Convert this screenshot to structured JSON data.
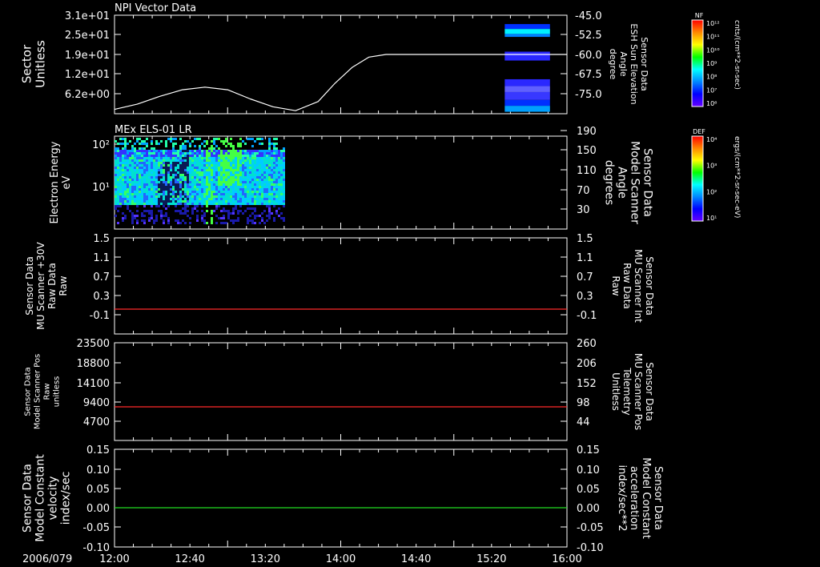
{
  "date_label": "2006/079",
  "x_ticks": [
    "12:00",
    "12:40",
    "13:20",
    "14:00",
    "14:40",
    "15:20",
    "16:00"
  ],
  "chart_data": [
    {
      "type": "heatmap",
      "title": "NPI Vector Data",
      "ylabel_lines": [
        "Sector",
        "Unitless"
      ],
      "y_ticks": [
        "3.1e+01",
        "2.5e+01",
        "1.9e+01",
        "1.2e+01",
        "6.2e+00"
      ],
      "right_ylabel_lines": [
        "Sensor Data",
        "ESH Sun Elevation",
        "Angle",
        "degree"
      ],
      "right_y_ticks": [
        "-45.0",
        "-52.5",
        "-60.0",
        "-67.5",
        "-75.0"
      ],
      "right_ylim": [
        -82.5,
        -45.0
      ],
      "line_series": {
        "color": "#ffffff",
        "x_hours": [
          0,
          0.2,
          0.4,
          0.6,
          0.8,
          1.0,
          1.2,
          1.4,
          1.6,
          1.8,
          1.95,
          2.1,
          2.25,
          2.4,
          2.6,
          3.0,
          4.0
        ],
        "y": [
          -81.0,
          -79.0,
          -76.0,
          -73.5,
          -72.5,
          -73.5,
          -77.0,
          -80.0,
          -81.5,
          -78.0,
          -71.0,
          -65.0,
          -61.0,
          -60.0,
          -60.0,
          -60.0,
          -60.0
        ]
      },
      "heat_blocks": [
        {
          "x0": 3.45,
          "x1": 3.85,
          "y0": 0.09,
          "y1": 0.14,
          "color": "#0030ff"
        },
        {
          "x0": 3.45,
          "x1": 3.85,
          "y0": 0.14,
          "y1": 0.19,
          "color": "#00f0ff"
        },
        {
          "x0": 3.45,
          "x1": 3.85,
          "y0": 0.19,
          "y1": 0.22,
          "color": "#0080ff"
        },
        {
          "x0": 3.45,
          "x1": 3.85,
          "y0": 0.37,
          "y1": 0.46,
          "color": "#2a28ff"
        },
        {
          "x0": 3.45,
          "x1": 3.85,
          "y0": 0.65,
          "y1": 0.72,
          "color": "#2a28ff"
        },
        {
          "x0": 3.45,
          "x1": 3.85,
          "y0": 0.72,
          "y1": 0.78,
          "color": "#6060ff"
        },
        {
          "x0": 3.45,
          "x1": 3.85,
          "y0": 0.78,
          "y1": 0.86,
          "color": "#3838ff"
        },
        {
          "x0": 3.45,
          "x1": 3.85,
          "y0": 0.86,
          "y1": 0.92,
          "color": "#0030ff"
        },
        {
          "x0": 3.45,
          "x1": 3.85,
          "y0": 0.92,
          "y1": 0.98,
          "color": "#00a0ff"
        }
      ],
      "colorbar": {
        "label": "NF",
        "unit": "cnts/(cm**2-sr-sec)",
        "ticks": [
          "10¹²",
          "10¹¹",
          "10¹⁰",
          "10⁹",
          "10⁸",
          "10⁷",
          "10⁶"
        ]
      }
    },
    {
      "type": "heatmap",
      "title": "MEx ELS-01 LR",
      "ylabel_lines": [
        "Electron Energy",
        "eV"
      ],
      "y_ticks": [
        "10²",
        "10¹"
      ],
      "right_ylabel_lines": [
        "Sensor Data",
        "Model Scanner",
        "Angle",
        "degrees"
      ],
      "right_y_ticks": [
        "190",
        "150",
        "110",
        "70",
        "30"
      ],
      "data_x_range_hours": [
        0,
        1.5
      ],
      "colorbar": {
        "label": "DEF",
        "unit": "ergs/(cm**2-sr-sec-eV)",
        "ticks": [
          "10⁴",
          "10³",
          "10²",
          "10¹"
        ]
      }
    },
    {
      "type": "line",
      "ylabel_lines": [
        "Sensor Data",
        "MU Scanner +30V",
        "Raw Data",
        "Raw"
      ],
      "y_ticks": [
        "1.5",
        "1.1",
        "0.7",
        "0.3",
        "-0.1"
      ],
      "ylim": [
        -0.42,
        1.5
      ],
      "right_ylabel_lines": [
        "Sensor Data",
        "MU Scanner Int",
        "Raw Data",
        "Raw"
      ],
      "right_y_ticks": [
        "1.5",
        "1.1",
        "0.7",
        "0.3",
        "-0.1"
      ],
      "right_color": "#ff2a2a",
      "series": [
        {
          "color": "#ff2a2a",
          "x_hours": [
            0,
            4
          ],
          "y": [
            0.0,
            0.0
          ]
        }
      ]
    },
    {
      "type": "line",
      "ylabel_lines": [
        "Sensor Data",
        "Model Scanner Pos",
        "Raw",
        "unitless"
      ],
      "y_ticks": [
        "23500",
        "18800",
        "14100",
        "9400",
        "4700"
      ],
      "ylim": [
        0,
        23500
      ],
      "right_ylabel_lines": [
        "Sensor Data",
        "MU Scanner Pos",
        "Telemetry",
        "Unitless"
      ],
      "right_y_ticks": [
        "260",
        "206",
        "152",
        "98",
        "44"
      ],
      "right_color": "#ff2a2a",
      "series": [
        {
          "color": "#ff2a2a",
          "x_hours": [
            0,
            4
          ],
          "y": [
            7800,
            7800
          ]
        }
      ]
    },
    {
      "type": "line",
      "ylabel_lines": [
        "Sensor Data",
        "Model Constant",
        "velocity",
        "index/sec"
      ],
      "y_ticks": [
        "0.15",
        "0.10",
        "0.05",
        "0.00",
        "-0.05",
        "-0.10"
      ],
      "ylim": [
        -0.1,
        0.15
      ],
      "right_ylabel_lines": [
        "Sensor Data",
        "Model Constant",
        "acceleration",
        "index/sec**2"
      ],
      "right_y_ticks": [
        "0.15",
        "0.10",
        "0.05",
        "0.00",
        "-0.05",
        "-0.10"
      ],
      "right_color": "#22dd22",
      "series": [
        {
          "color": "#22dd22",
          "x_hours": [
            0,
            4
          ],
          "y": [
            0.0,
            0.0
          ]
        }
      ]
    }
  ]
}
